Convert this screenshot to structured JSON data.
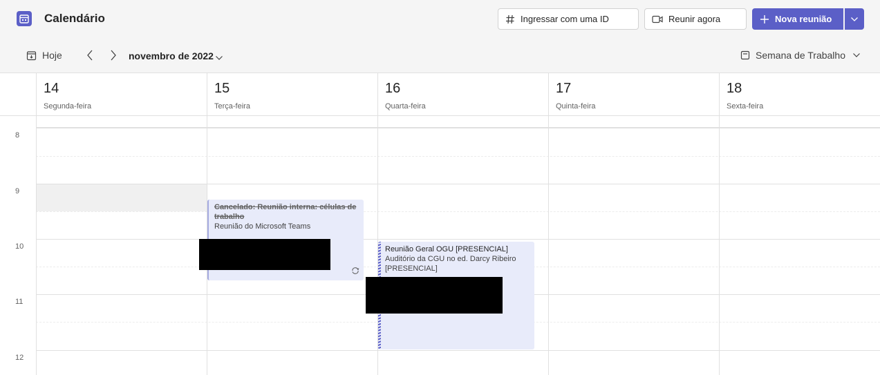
{
  "app": {
    "title": "Calendário"
  },
  "header": {
    "join_id_label": "Ingressar com uma ID",
    "meet_now_label": "Reunir agora",
    "new_meeting_label": "Nova reunião"
  },
  "toolbar": {
    "today_label": "Hoje",
    "month_label": "novembro de 2022",
    "view_label": "Semana de Trabalho"
  },
  "days": [
    {
      "num": "14",
      "name": "Segunda-feira"
    },
    {
      "num": "15",
      "name": "Terça-feira"
    },
    {
      "num": "16",
      "name": "Quarta-feira"
    },
    {
      "num": "17",
      "name": "Quinta-feira"
    },
    {
      "num": "18",
      "name": "Sexta-feira"
    }
  ],
  "hours": [
    "8",
    "9",
    "10",
    "11",
    "12"
  ],
  "events": [
    {
      "title": "Cancelado: Reunião interna: células de trabalho",
      "subtitle": "Reunião do Microsoft Teams",
      "cancelled": true,
      "recurring": true
    },
    {
      "title": "Reunião Geral OGU [PRESENCIAL]",
      "subtitle": "Auditório da CGU no ed. Darcy Ribeiro [PRESENCIAL]",
      "cancelled": false,
      "recurring": false
    }
  ],
  "colors": {
    "accent": "#5b5fc7",
    "event_bg": "#e8ebfa"
  }
}
